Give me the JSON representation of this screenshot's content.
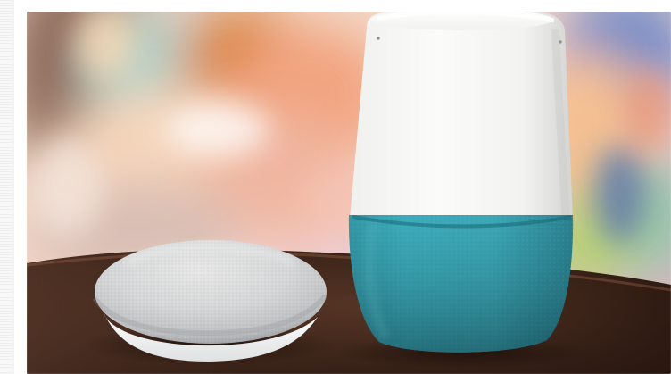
{
  "photo": {
    "subject": "smart-speakers-on-table"
  },
  "colors": {
    "speaker_base": "#3aa8b7",
    "speaker_top": "#f7f7f5",
    "mini_speaker_fabric": "#d7d8d9",
    "table_wood": "#3a2418",
    "background_blur_warm": "#f0b59f",
    "background_blur_cool": "#a8d7d6"
  }
}
